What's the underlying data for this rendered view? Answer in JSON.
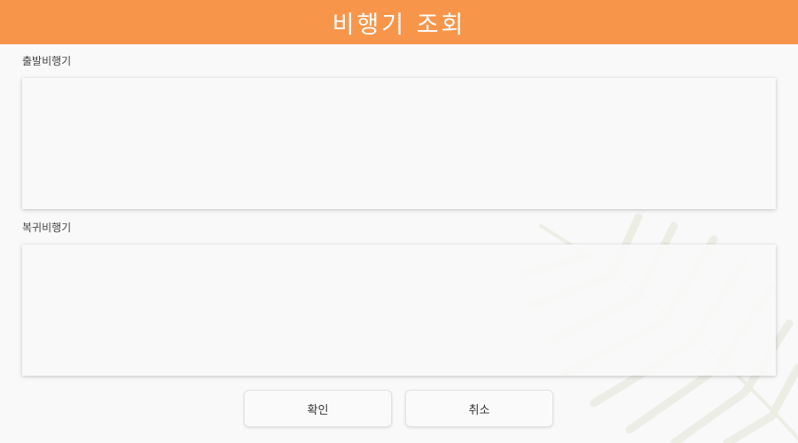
{
  "header": {
    "title": "비행기 조회",
    "background": "#f7964b"
  },
  "departure": {
    "label": "출발비행기"
  },
  "return_flight": {
    "label": "복귀비행기"
  },
  "buttons": {
    "confirm_label": "확인",
    "cancel_label": "취소"
  },
  "decoration": {
    "icon": "palm-leaf-icon"
  }
}
